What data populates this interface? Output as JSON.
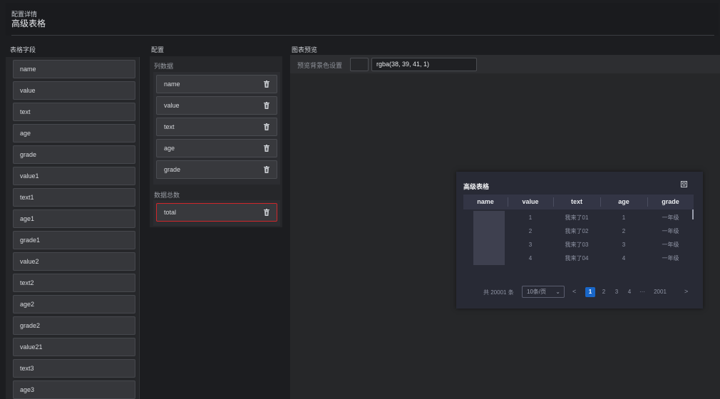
{
  "header": {
    "subtitle": "配置详情",
    "title": "高级表格"
  },
  "columns": {
    "fields_title": "表格字段",
    "config_title": "配置",
    "preview_title": "图表预览"
  },
  "fields": [
    "name",
    "value",
    "text",
    "age",
    "grade",
    "value1",
    "text1",
    "age1",
    "grade1",
    "value2",
    "text2",
    "age2",
    "grade2",
    "value21",
    "text3",
    "age3"
  ],
  "config": {
    "column_data_label": "列数据",
    "column_items": [
      "name",
      "value",
      "text",
      "age",
      "grade"
    ],
    "total_label": "数据总数",
    "total_item": "total"
  },
  "preview": {
    "bg_label": "预览背景色设置",
    "bg_value": "rgba(38, 39, 41, 1)",
    "swatch_color": "#26272a"
  },
  "table_card": {
    "title": "高级表格",
    "columns": [
      "name",
      "value",
      "text",
      "age",
      "grade"
    ],
    "rows": [
      {
        "value": "1",
        "text": "我来了01",
        "age": "1",
        "grade": "一年级"
      },
      {
        "value": "2",
        "text": "我来了02",
        "age": "2",
        "grade": "一年级"
      },
      {
        "value": "3",
        "text": "我来了03",
        "age": "3",
        "grade": "一年级"
      },
      {
        "value": "4",
        "text": "我来了04",
        "age": "4",
        "grade": "一年级"
      }
    ],
    "pagination": {
      "total_text": "共 20001 条",
      "page_size": "10条/页",
      "pages": [
        "1",
        "2",
        "3",
        "4"
      ],
      "ellipsis": "···",
      "last_page": "2001",
      "prev": "<",
      "next": ">"
    }
  },
  "colors": {
    "accent": "#1967c9",
    "highlight": "#d0262a"
  }
}
